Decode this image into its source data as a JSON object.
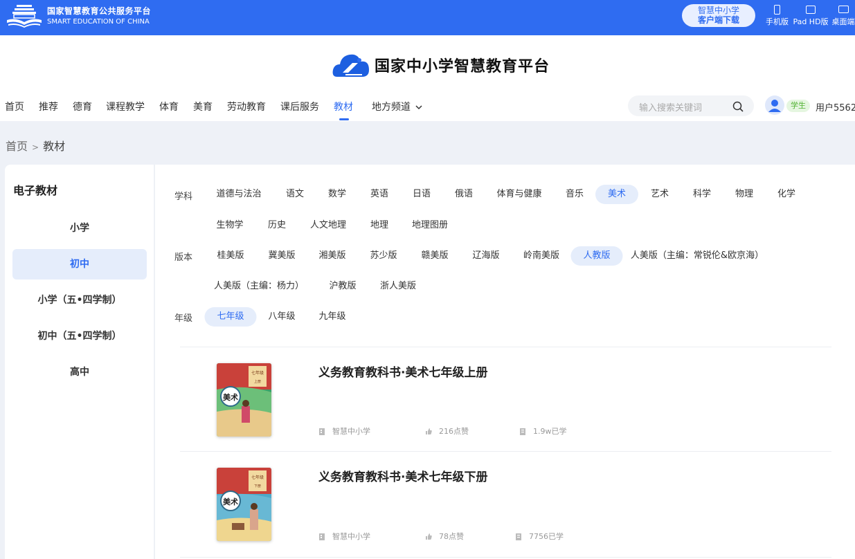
{
  "topbar": {
    "brand_cn": "国家智慧教育公共服务平台",
    "brand_en": "SMART EDUCATION OF CHINA",
    "download_line1": "智慧中小学",
    "download_line2": "客户端下载",
    "devices": [
      {
        "label": "手机版",
        "icon": "phone-icon"
      },
      {
        "label": "Pad HD版",
        "icon": "tablet-icon"
      },
      {
        "label": "桌面端",
        "icon": "desktop-icon"
      }
    ]
  },
  "header": {
    "platform_title": "国家中小学智慧教育平台",
    "nav": [
      "首页",
      "推荐",
      "德育",
      "课程教学",
      "体育",
      "美育",
      "劳动教育",
      "课后服务",
      "教材",
      "地方频道"
    ],
    "active_nav": "教材",
    "search_placeholder": "输入搜索关键词",
    "role_badge": "学生",
    "username": "用户5562"
  },
  "breadcrumb": {
    "home": "首页",
    "sep": ">",
    "current": "教材"
  },
  "sidebar": {
    "title": "电子教材",
    "items": [
      "小学",
      "初中",
      "小学（五•四学制）",
      "初中（五•四学制）",
      "高中"
    ],
    "active": "初中"
  },
  "filters": {
    "subject_label": "学科",
    "subjects_row1": [
      "道德与法治",
      "语文",
      "数学",
      "英语",
      "日语",
      "俄语",
      "体育与健康",
      "音乐",
      "美术",
      "艺术",
      "科学",
      "物理",
      "化学"
    ],
    "subjects_row2": [
      "生物学",
      "历史",
      "人文地理",
      "地理",
      "地理图册"
    ],
    "active_subject": "美术",
    "edition_label": "版本",
    "editions_row1": [
      "桂美版",
      "冀美版",
      "湘美版",
      "苏少版",
      "赣美版",
      "辽海版",
      "岭南美版",
      "人教版",
      "人美版（主编：常锐伦&欧京海）"
    ],
    "editions_row2": [
      "人美版（主编：杨力）",
      "沪教版",
      "浙人美版"
    ],
    "active_edition": "人教版",
    "grade_label": "年级",
    "grades": [
      "七年级",
      "八年级",
      "九年级"
    ],
    "active_grade": "七年级"
  },
  "books": [
    {
      "title": "义务教育教科书·美术七年级上册",
      "publisher": "智慧中小学",
      "likes": "216点赞",
      "learners": "1.9w已学",
      "cover_subject": "美术",
      "cover_grade": "七年级",
      "cover_term": "上册",
      "cover_color": "#c9413a"
    },
    {
      "title": "义务教育教科书·美术七年级下册",
      "publisher": "智慧中小学",
      "likes": "78点赞",
      "learners": "7756已学",
      "cover_subject": "美术",
      "cover_grade": "七年级",
      "cover_term": "下册",
      "cover_color": "#c9413a"
    }
  ],
  "colors": {
    "primary": "#2f6cf1",
    "active_bg": "#e5edfb",
    "student_badge": "#52b234"
  }
}
